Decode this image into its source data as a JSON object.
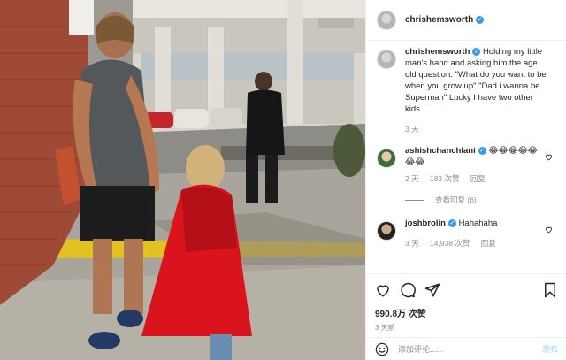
{
  "post": {
    "author": "chrishemsworth",
    "verified_icon": "verified-badge-icon",
    "caption": "Holding my little man's hand and asking him the age old question. \"What do you want to be when you grow up\" \"Dad i wanna be Superman\" Lucky I have two other kids",
    "caption_time": "3 天",
    "likes": "990.8万 次赞",
    "time": "3 天前"
  },
  "comments": [
    {
      "user": "ashishchanchlani",
      "text": "😂😂😂😂😂😂😂",
      "time": "2 天",
      "likes": "183 次赞",
      "reply": "回复",
      "view_replies": "查看回复 (6)"
    },
    {
      "user": "joshbrolin",
      "text": "Hahahaha",
      "time": "3 天",
      "likes": "14,938 次赞",
      "reply": "回复"
    }
  ],
  "add_comment": {
    "placeholder": "添加评论......",
    "post_label": "发布"
  },
  "icons": [
    "heart-icon",
    "comment-icon",
    "share-icon",
    "bookmark-icon",
    "emoji-icon"
  ],
  "colors": {
    "accent": "#3897f0",
    "muted": "#8e8e8e",
    "border": "#efefef",
    "cape": "#d9141c"
  }
}
